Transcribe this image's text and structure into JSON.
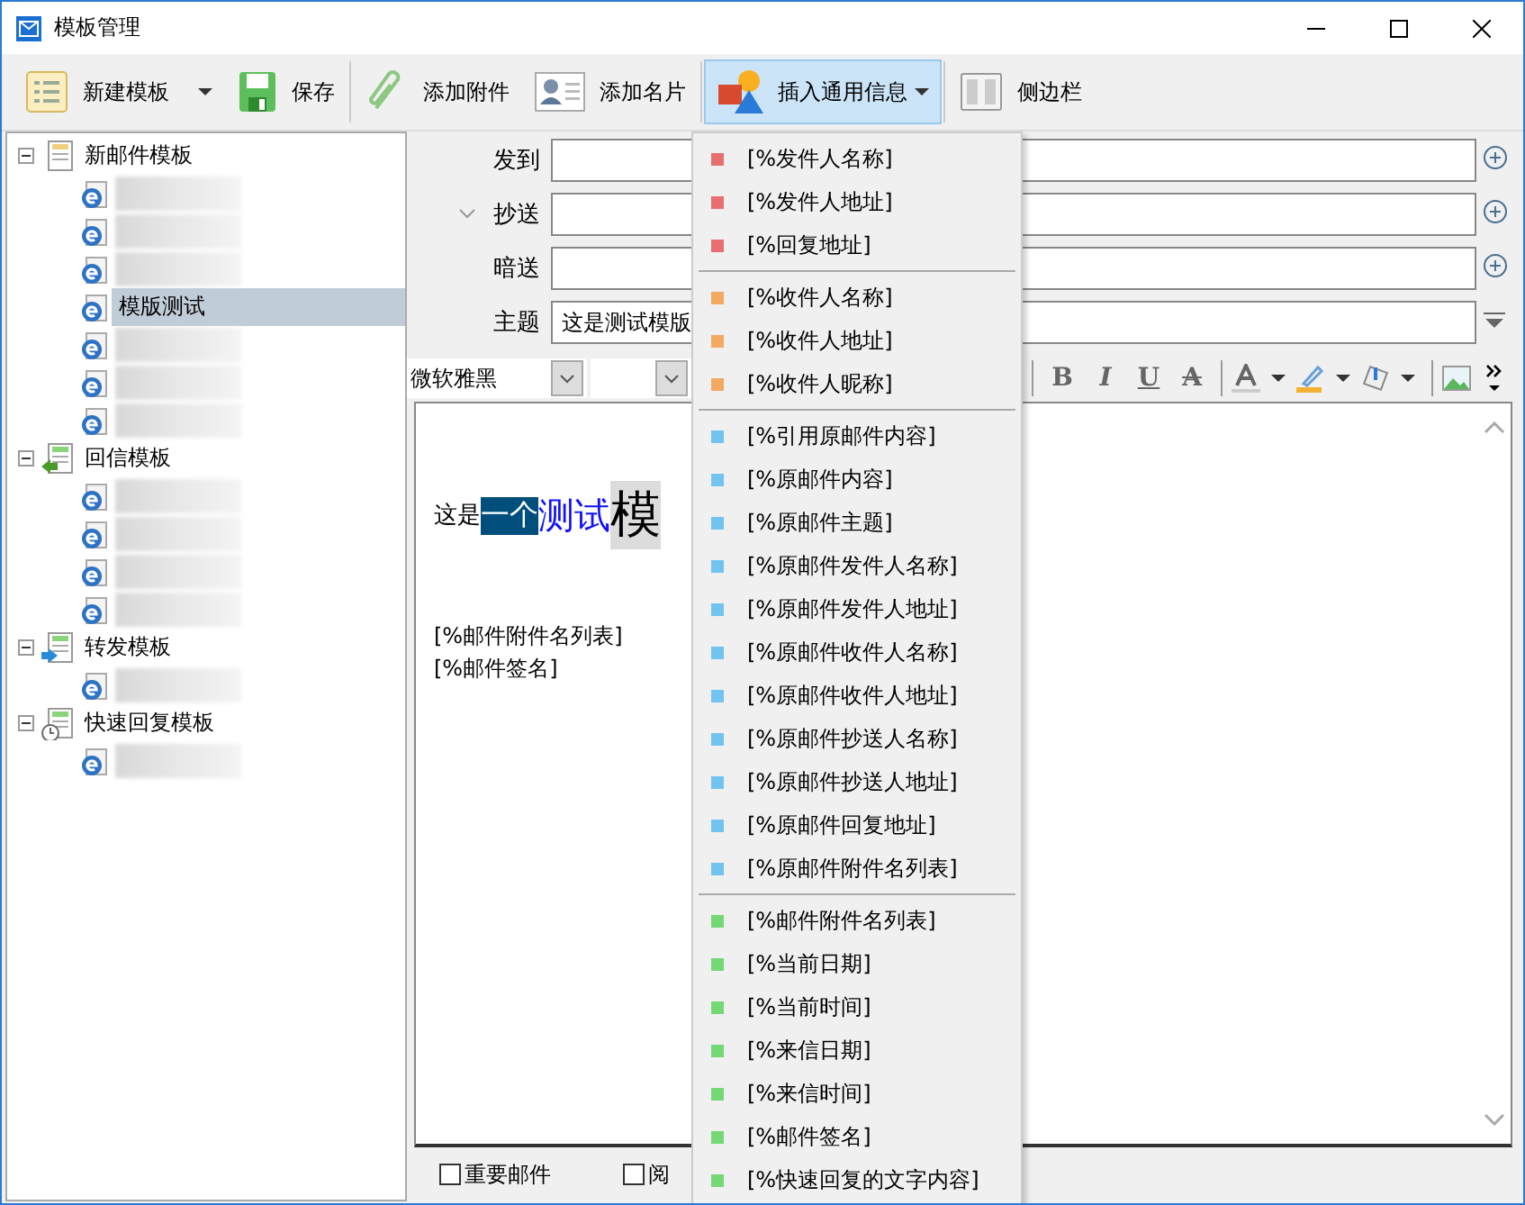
{
  "window": {
    "title": "模板管理"
  },
  "toolbar": [
    {
      "kind": "list",
      "label": "新建模板",
      "dropdown": true,
      "pressed": false
    },
    {
      "kind": "save",
      "label": "保存",
      "dropdown": false,
      "pressed": false
    },
    {
      "kind": "clip",
      "label": "添加附件",
      "dropdown": false,
      "pressed": false
    },
    {
      "kind": "card",
      "label": "添加名片",
      "dropdown": false,
      "pressed": false
    },
    {
      "kind": "shapes",
      "label": "插入通用信息",
      "dropdown": true,
      "pressed": true
    },
    {
      "kind": "sidebar",
      "label": "侧边栏",
      "dropdown": false,
      "pressed": false
    }
  ],
  "tree": [
    {
      "label": "新邮件模板",
      "kind": "new",
      "expanded": true,
      "children": [
        {
          "blurred": true,
          "selected": false
        },
        {
          "blurred": true,
          "selected": false
        },
        {
          "blurred": true,
          "selected": false
        },
        {
          "label": "模版测试",
          "blurred": false,
          "selected": true
        },
        {
          "blurred": true,
          "selected": false
        },
        {
          "blurred": true,
          "selected": false
        },
        {
          "blurred": true,
          "selected": false
        }
      ]
    },
    {
      "label": "回信模板",
      "kind": "reply",
      "expanded": true,
      "children": [
        {
          "blurred": true,
          "selected": false
        },
        {
          "blurred": true,
          "selected": false
        },
        {
          "blurred": true,
          "selected": false
        },
        {
          "blurred": true,
          "selected": false
        }
      ]
    },
    {
      "label": "转发模板",
      "kind": "forward",
      "expanded": true,
      "children": [
        {
          "blurred": true,
          "selected": false
        }
      ]
    },
    {
      "label": "快速回复模板",
      "kind": "quick",
      "expanded": true,
      "children": [
        {
          "blurred": true,
          "selected": false
        }
      ]
    }
  ],
  "fields": [
    {
      "label": "发到",
      "kind": "add",
      "chevron": false
    },
    {
      "label": "抄送",
      "kind": "add",
      "chevron": true
    },
    {
      "label": "暗送",
      "kind": "add",
      "chevron": false
    },
    {
      "label": "主题",
      "kind": "more",
      "value": "这是测试模版",
      "chevron": false
    }
  ],
  "font": {
    "family": "微软雅黑"
  },
  "format_buttons": [
    "B",
    "I",
    "U",
    "A"
  ],
  "editor": {
    "line": [
      {
        "kind": "plain",
        "text": "这是"
      },
      {
        "kind": "highlight",
        "text": "一个"
      },
      {
        "kind": "blue",
        "text": "测试"
      },
      {
        "kind": "big",
        "text": "模"
      }
    ],
    "tags": [
      "[%邮件附件名列表]",
      "[%邮件签名]"
    ]
  },
  "checkboxes": [
    {
      "label": "重要邮件",
      "checked": false
    },
    {
      "label": "阅",
      "checked": false
    }
  ],
  "menu": [
    {
      "label": "[%发件人名称]",
      "color": "#e86f6f"
    },
    {
      "label": "[%发件人地址]",
      "color": "#e86f6f"
    },
    {
      "label": "[%回复地址]",
      "color": "#e86f6f"
    },
    {
      "kind": "separator"
    },
    {
      "label": "[%收件人名称]",
      "color": "#f4a963"
    },
    {
      "label": "[%收件人地址]",
      "color": "#f4a963"
    },
    {
      "label": "[%收件人昵称]",
      "color": "#f4a963"
    },
    {
      "kind": "separator"
    },
    {
      "label": "[%引用原邮件内容]",
      "color": "#71c4f0"
    },
    {
      "label": "[%原邮件内容]",
      "color": "#71c4f0"
    },
    {
      "label": "[%原邮件主题]",
      "color": "#71c4f0"
    },
    {
      "label": "[%原邮件发件人名称]",
      "color": "#71c4f0"
    },
    {
      "label": "[%原邮件发件人地址]",
      "color": "#71c4f0"
    },
    {
      "label": "[%原邮件收件人名称]",
      "color": "#71c4f0"
    },
    {
      "label": "[%原邮件收件人地址]",
      "color": "#71c4f0"
    },
    {
      "label": "[%原邮件抄送人名称]",
      "color": "#71c4f0"
    },
    {
      "label": "[%原邮件抄送人地址]",
      "color": "#71c4f0"
    },
    {
      "label": "[%原邮件回复地址]",
      "color": "#71c4f0"
    },
    {
      "label": "[%原邮件附件名列表]",
      "color": "#71c4f0"
    },
    {
      "kind": "separator"
    },
    {
      "label": "[%邮件附件名列表]",
      "color": "#74d874"
    },
    {
      "label": "[%当前日期]",
      "color": "#74d874"
    },
    {
      "label": "[%当前时间]",
      "color": "#74d874"
    },
    {
      "label": "[%来信日期]",
      "color": "#74d874"
    },
    {
      "label": "[%来信时间]",
      "color": "#74d874"
    },
    {
      "label": "[%邮件签名]",
      "color": "#74d874"
    },
    {
      "label": "[%快速回复的文字内容]",
      "color": "#74d874"
    }
  ]
}
